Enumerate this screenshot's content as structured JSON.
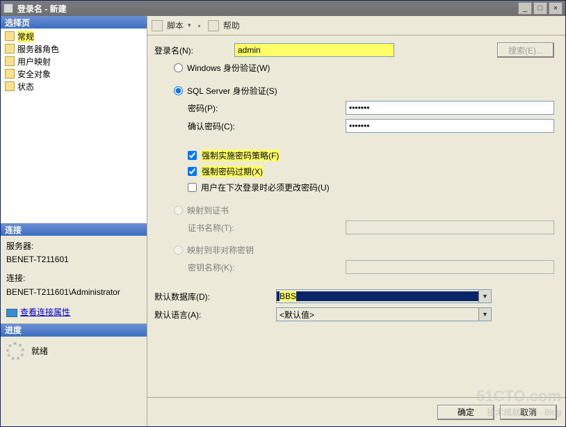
{
  "window": {
    "title": "登录名 - 新建"
  },
  "winbtns": {
    "min": "_",
    "max": "□",
    "close": "×"
  },
  "left": {
    "select_page_hdr": "选择页",
    "nav": [
      {
        "label": "常规",
        "hl": true
      },
      {
        "label": "服务器角色"
      },
      {
        "label": "用户映射"
      },
      {
        "label": "安全对象"
      },
      {
        "label": "状态"
      }
    ],
    "conn_hdr": "连接",
    "server_lbl": "服务器:",
    "server_val": "BENET-T211601",
    "conn_lbl": "连接:",
    "conn_val": "BENET-T211601\\Administrator",
    "view_props": "查看连接属性",
    "progress_hdr": "进度",
    "progress_val": "就绪"
  },
  "toolbar": {
    "script": "脚本",
    "help": "帮助",
    "drop": "▾",
    "sep": "▪"
  },
  "form": {
    "login_name_lbl": "登录名(N):",
    "login_name_val": "admin",
    "search_btn": "搜索(E)...",
    "win_auth": "Windows 身份验证(W)",
    "sql_auth": "SQL Server 身份验证(S)",
    "pwd_lbl": "密码(P):",
    "pwd_val": "*******",
    "pwd_confirm_lbl": "确认密码(C):",
    "pwd_confirm_val": "*******",
    "enforce_policy": "强制实施密码策略(F)",
    "enforce_expire": "强制密码过期(X)",
    "must_change": "用户在下次登录时必须更改密码(U)",
    "map_cert": "映射到证书",
    "cert_name_lbl": "证书名称(T):",
    "map_asym": "映射到非对称密钥",
    "key_name_lbl": "密钥名称(K):",
    "def_db_lbl": "默认数据库(D):",
    "def_db_val": "BBS",
    "def_lang_lbl": "默认语言(A):",
    "def_lang_val": "<默认值>"
  },
  "footer": {
    "ok": "确定",
    "cancel": "取消"
  },
  "watermark": {
    "a": "51CTO.com",
    "b": "技术成就梦想 · Blog"
  }
}
